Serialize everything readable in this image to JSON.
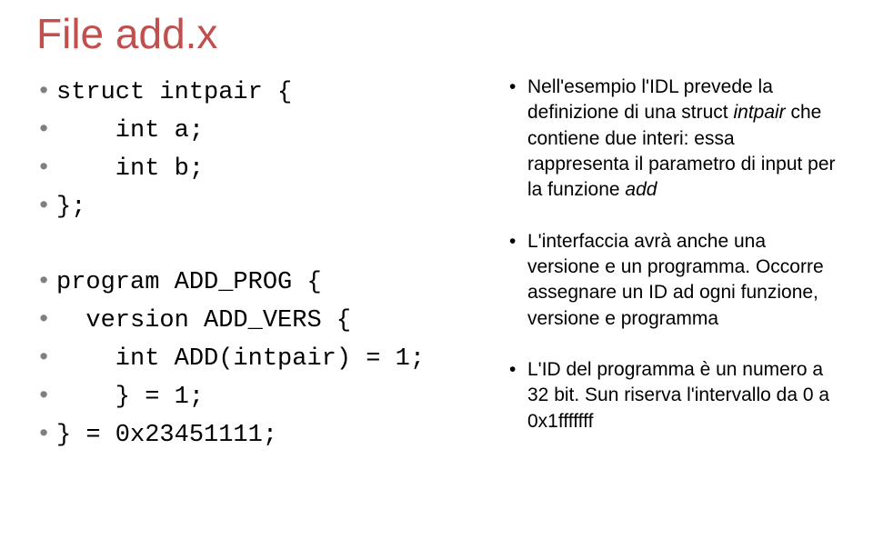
{
  "title": "File add.x",
  "code": {
    "l1": "struct intpair {",
    "l2": "    int a;",
    "l3": "    int b;",
    "l4": "};",
    "l5": "program ADD_PROG {",
    "l6": "  version ADD_VERS {",
    "l7": "    int ADD(intpair) = 1;",
    "l8": "    } = 1;",
    "l9": "} = 0x23451111;"
  },
  "notes": {
    "p1a": "Nell'esempio l'IDL prevede la definizione di una struct ",
    "p1b": "intpair",
    "p1c": " che contiene due interi: essa rappresenta il parametro di input per la funzione ",
    "p1d": "add",
    "p2": "L'interfaccia avrà anche una versione e un programma. Occorre assegnare un ID ad ogni funzione, versione e programma",
    "p3": "L'ID del programma è un numero a 32 bit. Sun riserva l'intervallo da 0 a 0x1fffffff"
  }
}
